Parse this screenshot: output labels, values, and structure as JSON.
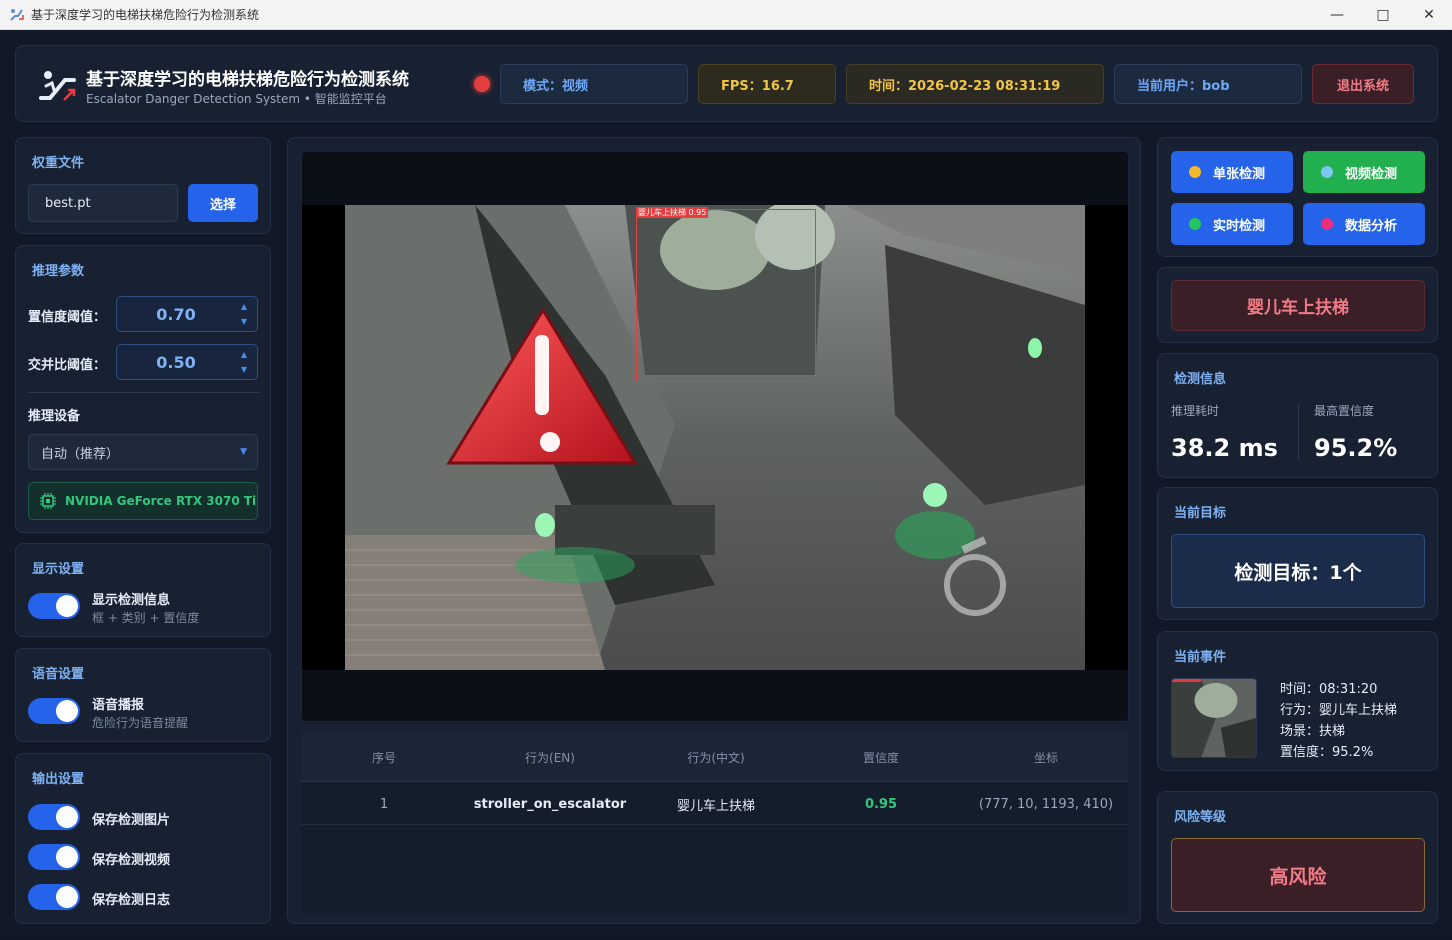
{
  "window": {
    "title": "基于深度学习的电梯扶梯危险行为检测系统"
  },
  "header": {
    "title": "基于深度学习的电梯扶梯危险行为检测系统",
    "subtitle": "Escalator Danger Detection System • 智能监控平台",
    "mode": "模式：视频",
    "fps": "FPS：16.7",
    "time": "时间：2026-02-23 08:31:19",
    "user": "当前用户：bob",
    "logout": "退出系统"
  },
  "weights": {
    "title": "权重文件",
    "file": "best.pt",
    "select": "选择"
  },
  "inference": {
    "title": "推理参数",
    "conf_label": "置信度阈值：",
    "conf_value": "0.70",
    "iou_label": "交并比阈值：",
    "iou_value": "0.50",
    "device_label": "推理设备",
    "device_value": "自动（推荐）",
    "gpu": "NVIDIA GeForce RTX 3070 Ti"
  },
  "display": {
    "title": "显示设置",
    "toggle_label": "显示检测信息",
    "toggle_desc": "框 + 类别 + 置信度",
    "enabled": true
  },
  "voice": {
    "title": "语音设置",
    "toggle_label": "语音播报",
    "toggle_desc": "危险行为语音提醒",
    "enabled": true
  },
  "output": {
    "title": "输出设置",
    "items": [
      {
        "label": "保存检测图片",
        "enabled": true
      },
      {
        "label": "保存检测视频",
        "enabled": true
      },
      {
        "label": "保存检测日志",
        "enabled": true
      }
    ]
  },
  "video": {
    "detection_label": "婴儿车上扶梯 0.95"
  },
  "table": {
    "headers": [
      "序号",
      "行为(EN)",
      "行为(中文)",
      "置信度",
      "坐标"
    ],
    "rows": [
      {
        "index": "1",
        "en": "stroller_on_escalator",
        "cn": "婴儿车上扶梯",
        "conf": "0.95",
        "coords": "(777, 10, 1193, 410)"
      }
    ]
  },
  "modes": {
    "single": "单张检测",
    "video": "视频检测",
    "realtime": "实时检测",
    "analysis": "数据分析"
  },
  "alert": "婴儿车上扶梯",
  "info": {
    "title": "检测信息",
    "latency_label": "推理耗时",
    "latency_value": "38.2 ms",
    "max_conf_label": "最高置信度",
    "max_conf_value": "95.2%"
  },
  "target": {
    "title": "当前目标",
    "text": "检测目标：1个"
  },
  "event": {
    "title": "当前事件",
    "time": "时间：08:31:20",
    "behavior": "行为：婴儿车上扶梯",
    "scene": "场景：扶梯",
    "confidence": "置信度：95.2%"
  },
  "risk": {
    "title": "风险等级",
    "level": "高风险"
  },
  "colors": {
    "accent": "#2563eb",
    "green": "#22c55e",
    "danger": "#e43e3e",
    "warning": "#f2c542"
  }
}
